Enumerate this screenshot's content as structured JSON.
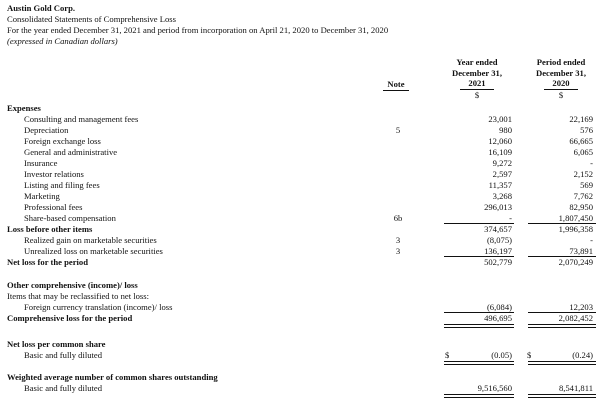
{
  "header": {
    "company": "Austin Gold Corp.",
    "statement": "Consolidated Statements of Comprehensive Loss",
    "period": "For the year ended December 31, 2021 and period from incorporation on April 21, 2020 to December 31, 2020",
    "currency_note": "(expressed in Canadian dollars)"
  },
  "columns": {
    "note": "Note",
    "col1": [
      "Year ended",
      "December 31,",
      "2021"
    ],
    "col2": [
      "Period ended",
      "December 31,",
      "2020"
    ],
    "currency": "$"
  },
  "rows": [
    {
      "label": "Expenses",
      "style": "bold",
      "note": "",
      "v1": "",
      "v2": ""
    },
    {
      "label": "Consulting and management fees",
      "style": "indent",
      "note": "",
      "v1": "23,001",
      "v2": "22,169"
    },
    {
      "label": "Depreciation",
      "style": "indent",
      "note": "5",
      "v1": "980",
      "v2": "576"
    },
    {
      "label": "Foreign exchange loss",
      "style": "indent",
      "note": "",
      "v1": "12,060",
      "v2": "66,665"
    },
    {
      "label": "General and administrative",
      "style": "indent",
      "note": "",
      "v1": "16,109",
      "v2": "6,065"
    },
    {
      "label": "Insurance",
      "style": "indent",
      "note": "",
      "v1": "9,272",
      "v2": "-"
    },
    {
      "label": "Investor relations",
      "style": "indent",
      "note": "",
      "v1": "2,597",
      "v2": "2,152"
    },
    {
      "label": "Listing and filing fees",
      "style": "indent",
      "note": "",
      "v1": "11,357",
      "v2": "569"
    },
    {
      "label": "Marketing",
      "style": "indent",
      "note": "",
      "v1": "3,268",
      "v2": "7,762"
    },
    {
      "label": "Professional fees",
      "style": "indent",
      "note": "",
      "v1": "296,013",
      "v2": "82,950"
    },
    {
      "label": "Share-based compensation",
      "style": "indent",
      "note": "6b",
      "v1": "-",
      "v2": "1,807,450"
    },
    {
      "label": "Loss before other items",
      "style": "bold",
      "note": "",
      "v1": "374,657",
      "v2": "1,996,358"
    },
    {
      "label": "Realized gain on marketable securities",
      "style": "indent",
      "note": "3",
      "v1": "(8,075)",
      "v2": "-"
    },
    {
      "label": "Unrealized loss on marketable securities",
      "style": "indent",
      "note": "3",
      "v1": "136,197",
      "v2": "73,891"
    },
    {
      "label": "Net loss for the period",
      "style": "bold",
      "note": "",
      "v1": "502,779",
      "v2": "2,070,249"
    },
    {
      "label": "Other comprehensive (income)/ loss",
      "style": "bold",
      "note": "",
      "v1": "",
      "v2": ""
    },
    {
      "label": "Items that may be reclassified to net loss:",
      "style": "plain",
      "note": "",
      "v1": "",
      "v2": ""
    },
    {
      "label": "Foreign currency translation (income)/ loss",
      "style": "indent",
      "note": "",
      "v1": "(6,084)",
      "v2": "12,203"
    },
    {
      "label": "Comprehensive loss for the period",
      "style": "bold",
      "note": "",
      "v1": "496,695",
      "v2": "2,082,452"
    },
    {
      "label": "Net loss per common share",
      "style": "bold",
      "note": "",
      "v1": "",
      "v2": ""
    },
    {
      "label": "Basic and fully diluted",
      "style": "indent",
      "note": "",
      "v1": "(0.05)",
      "v2": "(0.24)",
      "dollar": "$"
    },
    {
      "label": "Weighted average number of common shares outstanding",
      "style": "bold",
      "note": "",
      "v1": "",
      "v2": ""
    },
    {
      "label": "Basic and fully diluted",
      "style": "indent",
      "note": "",
      "v1": "9,516,560",
      "v2": "8,541,811"
    }
  ]
}
